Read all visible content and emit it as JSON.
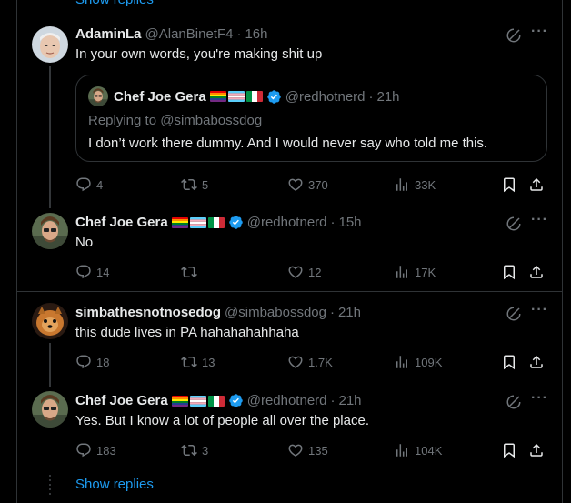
{
  "top_show_replies": "Show replies",
  "posts": [
    {
      "name": "AdaminLa",
      "handle": "@AlanBinetF4",
      "time": "16h",
      "text": "In your own words,  you're making shit up",
      "quote": {
        "name": "Chef Joe Gera",
        "handle": "@redhotnerd",
        "time": "21h",
        "replying": "Replying to @simbabossdog",
        "text": "I don’t work there dummy. And I would never say who told me this."
      },
      "stats": {
        "replies": "4",
        "reposts": "5",
        "likes": "370",
        "views": "33K"
      }
    },
    {
      "name": "Chef Joe Gera",
      "handle": "@redhotnerd",
      "time": "15h",
      "text": "No",
      "stats": {
        "replies": "14",
        "reposts": "",
        "likes": "12",
        "views": "17K"
      }
    },
    {
      "name": "simbathesnotnosedog",
      "handle": "@simbabossdog",
      "time": "21h",
      "text": "this dude lives in PA hahahahahhaha",
      "stats": {
        "replies": "18",
        "reposts": "13",
        "likes": "1.7K",
        "views": "109K"
      }
    },
    {
      "name": "Chef Joe Gera",
      "handle": "@redhotnerd",
      "time": "21h",
      "text": "Yes. But I know a lot of people all over the place.",
      "stats": {
        "replies": "183",
        "reposts": "3",
        "likes": "135",
        "views": "104K"
      }
    }
  ],
  "bottom_show_replies": "Show replies",
  "colors": {
    "accent": "#1d9bf0",
    "muted": "#71767b",
    "border": "#2f3336",
    "verified": "#1d9bf0"
  },
  "icons": [
    "reply-icon",
    "repost-icon",
    "like-icon",
    "views-icon",
    "bookmark-icon",
    "share-icon",
    "grok-icon",
    "more-icon",
    "verified-icon"
  ]
}
